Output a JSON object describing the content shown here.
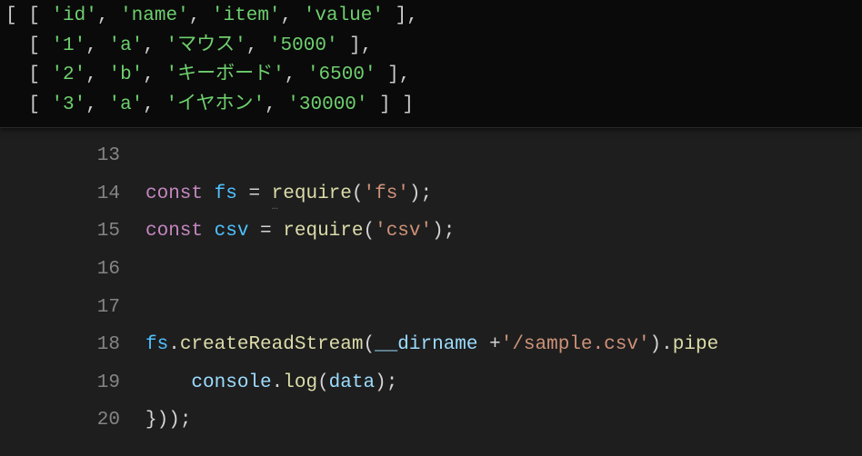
{
  "terminal": {
    "rows": [
      [
        "'id'",
        "'name'",
        "'item'",
        "'value'"
      ],
      [
        "'1'",
        "'a'",
        "'マウス'",
        "'5000'"
      ],
      [
        "'2'",
        "'b'",
        "'キーボード'",
        "'6500'"
      ],
      [
        "'3'",
        "'a'",
        "'イヤホン'",
        "'30000'"
      ]
    ]
  },
  "editor": {
    "lines": [
      {
        "num": "13",
        "tokens": []
      },
      {
        "num": "14",
        "tokens": [
          {
            "t": "keyword",
            "v": "const"
          },
          {
            "t": "space",
            "v": " "
          },
          {
            "t": "const",
            "v": "fs"
          },
          {
            "t": "space",
            "v": " "
          },
          {
            "t": "op",
            "v": "="
          },
          {
            "t": "space",
            "v": " "
          },
          {
            "t": "func",
            "v": "require",
            "dots": true
          },
          {
            "t": "paren",
            "v": "("
          },
          {
            "t": "string",
            "v": "'fs'"
          },
          {
            "t": "paren",
            "v": ")"
          },
          {
            "t": "punct",
            "v": ";"
          }
        ]
      },
      {
        "num": "15",
        "tokens": [
          {
            "t": "keyword",
            "v": "const"
          },
          {
            "t": "space",
            "v": " "
          },
          {
            "t": "const",
            "v": "csv"
          },
          {
            "t": "space",
            "v": " "
          },
          {
            "t": "op",
            "v": "="
          },
          {
            "t": "space",
            "v": " "
          },
          {
            "t": "func",
            "v": "require"
          },
          {
            "t": "paren",
            "v": "("
          },
          {
            "t": "string",
            "v": "'csv'"
          },
          {
            "t": "paren",
            "v": ")"
          },
          {
            "t": "punct",
            "v": ";"
          }
        ]
      },
      {
        "num": "16",
        "tokens": []
      },
      {
        "num": "17",
        "tokens": []
      },
      {
        "num": "18",
        "tokens": [
          {
            "t": "const",
            "v": "fs"
          },
          {
            "t": "punct",
            "v": "."
          },
          {
            "t": "func",
            "v": "createReadStream"
          },
          {
            "t": "paren",
            "v": "("
          },
          {
            "t": "var",
            "v": "__dirname"
          },
          {
            "t": "space",
            "v": " "
          },
          {
            "t": "op",
            "v": "+"
          },
          {
            "t": "string",
            "v": "'/sample.csv'"
          },
          {
            "t": "paren",
            "v": ")"
          },
          {
            "t": "punct",
            "v": "."
          },
          {
            "t": "func",
            "v": "pipe"
          }
        ]
      },
      {
        "num": "19",
        "tokens": [
          {
            "t": "space",
            "v": "    "
          },
          {
            "t": "var",
            "v": "console"
          },
          {
            "t": "punct",
            "v": "."
          },
          {
            "t": "func",
            "v": "log"
          },
          {
            "t": "paren",
            "v": "("
          },
          {
            "t": "var",
            "v": "data"
          },
          {
            "t": "paren",
            "v": ")"
          },
          {
            "t": "punct",
            "v": ";"
          }
        ]
      },
      {
        "num": "20",
        "tokens": [
          {
            "t": "punct",
            "v": "}"
          },
          {
            "t": "paren",
            "v": ")"
          },
          {
            "t": "paren",
            "v": ")"
          },
          {
            "t": "punct",
            "v": ";"
          }
        ]
      }
    ]
  }
}
